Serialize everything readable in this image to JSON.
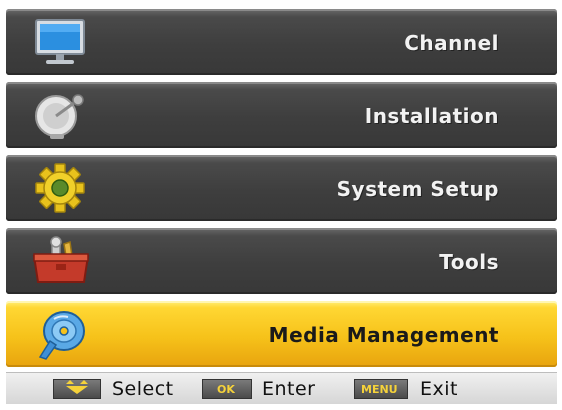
{
  "menu": {
    "items": [
      {
        "label": "Channel",
        "icon": "tv-monitor-icon",
        "selected": false
      },
      {
        "label": "Installation",
        "icon": "satellite-dish-icon",
        "selected": false
      },
      {
        "label": "System Setup",
        "icon": "gear-icon",
        "selected": false
      },
      {
        "label": "Tools",
        "icon": "toolbox-icon",
        "selected": false
      },
      {
        "label": "Media Management",
        "icon": "disc-icon",
        "selected": true
      }
    ]
  },
  "footer": {
    "select_label": "Select",
    "ok_key": "OK",
    "enter_label": "Enter",
    "menu_key": "MENU",
    "exit_label": "Exit"
  },
  "colors": {
    "item_bg": "#444444",
    "selected_bg": "#f6c21a",
    "item_text": "#f2f2f2",
    "selected_text": "#1a1a1a",
    "key_text": "#f5d23a"
  }
}
